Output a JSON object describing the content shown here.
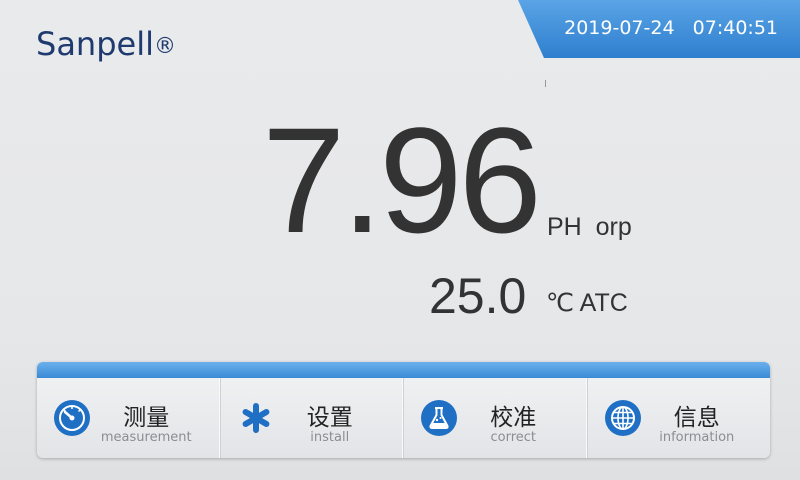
{
  "brand": {
    "name": "Sanpell",
    "mark": "®"
  },
  "status": {
    "date": "2019-07-24",
    "time": "07:40:51"
  },
  "measurement": {
    "value": "7.96",
    "unit": "PH  orp",
    "temperature": "25.0",
    "temperature_unit": "℃ ATC"
  },
  "menu": {
    "items": [
      {
        "cn": "测量",
        "en": "measurement",
        "icon": "gauge-icon"
      },
      {
        "cn": "设置",
        "en": "install",
        "icon": "snowflake-gear-icon"
      },
      {
        "cn": "校准",
        "en": "correct",
        "icon": "flask-icon"
      },
      {
        "cn": "信息",
        "en": "information",
        "icon": "globe-icon"
      }
    ]
  },
  "colors": {
    "accent": "#2f7fcf",
    "brand": "#1f3a6e",
    "icon_blue": "#1f6fc4"
  }
}
